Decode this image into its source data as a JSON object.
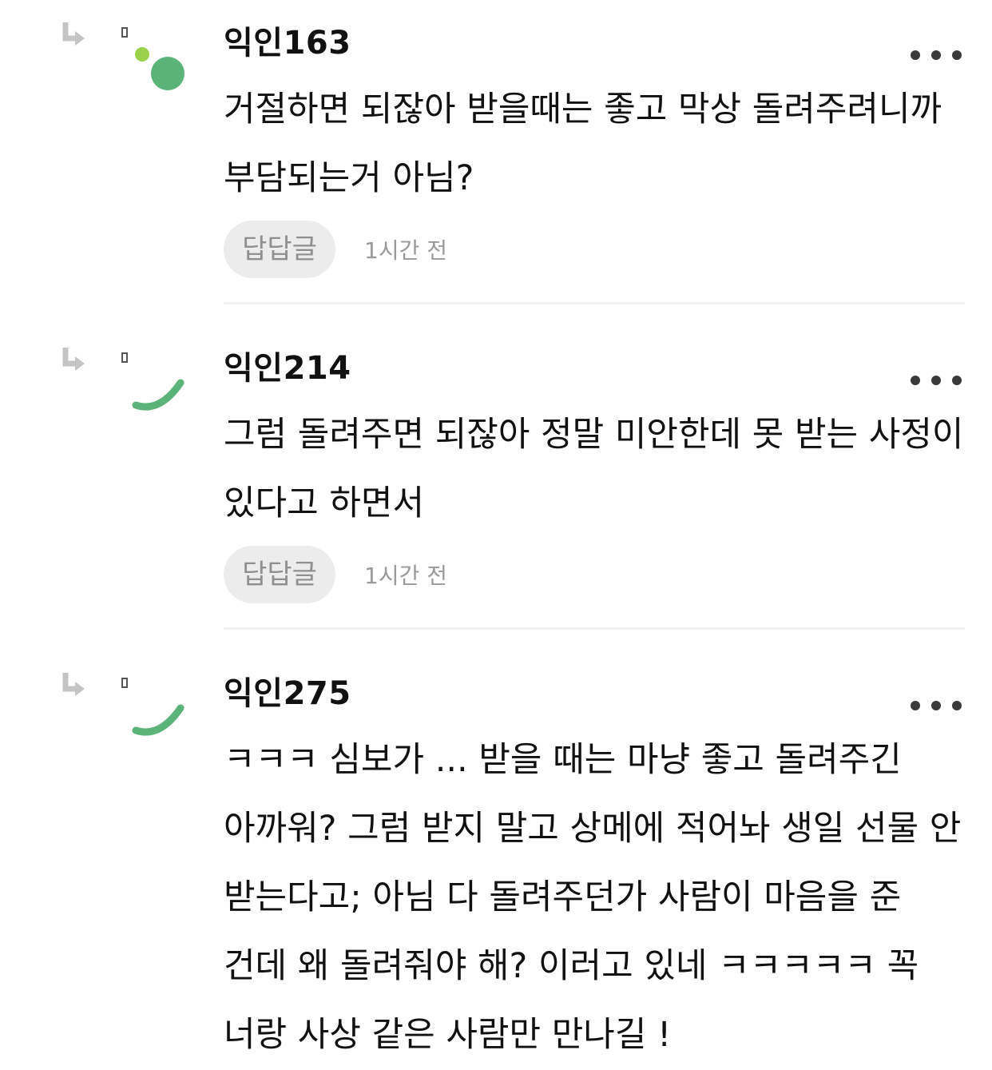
{
  "comments": [
    {
      "author": "익인163",
      "text": "거절하면 되잖아 받을때는 좋고 막상 돌려주려니까 부담되는거 아님?",
      "reply_label": "답답글",
      "time": "1시간 전",
      "avatar": "green-dots",
      "reply_icon": "reply-arrow-icon",
      "more_icon": "more-dots-icon"
    },
    {
      "author": "익인214",
      "text": "그럼 돌려주면 되잖아 정말 미안한데 못 받는 사정이 있다고 하면서",
      "reply_label": "답답글",
      "time": "1시간 전",
      "avatar": "green-arc",
      "reply_icon": "reply-arrow-icon",
      "more_icon": "more-dots-icon"
    },
    {
      "author": "익인275",
      "text": "ㅋㅋㅋ 심보가 ... 받을 때는 마냥 좋고 돌려주긴 아까워? 그럼 받지 말고 상메에 적어놔 생일 선물 안 받는다고; 아님 다 돌려주던가 사람이 마음을 준 건데 왜 돌려줘야 해? 이러고 있네 ㅋㅋㅋㅋㅋ 꼭 너랑 사상 같은 사람만 만나길 !",
      "avatar": "green-arc",
      "reply_icon": "reply-arrow-icon",
      "more_icon": "more-dots-icon"
    }
  ],
  "colors": {
    "avatar_green": "#5bb37a",
    "avatar_lime": "#9ad14b",
    "reply_button_bg": "#ececec",
    "muted_text": "#9a9a9a"
  }
}
